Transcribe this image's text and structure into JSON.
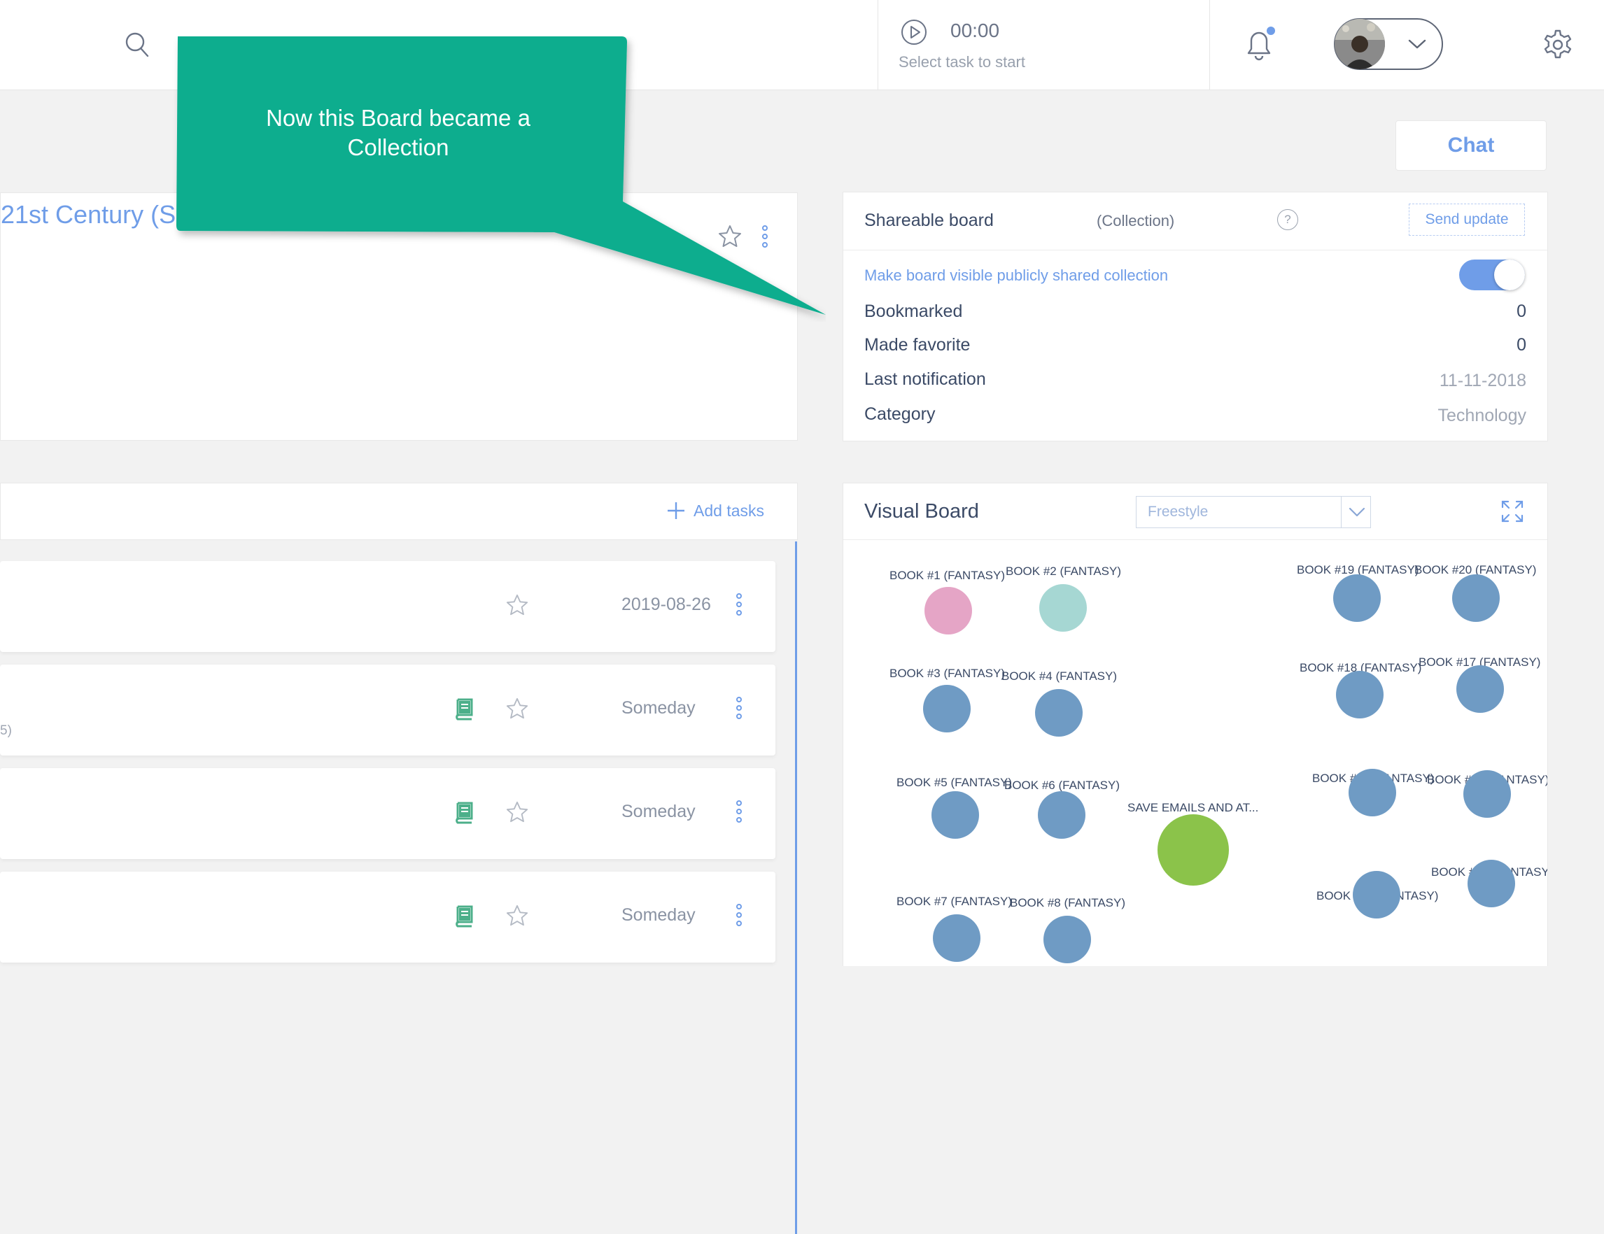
{
  "timer": {
    "time": "00:00",
    "hint": "Select task to start"
  },
  "header": {
    "chat_label": "Chat"
  },
  "board": {
    "title": "21st Century (Sc"
  },
  "callout": {
    "text": "Now this Board became a Collection"
  },
  "shareable": {
    "title": "Shareable board",
    "type": "(Collection)",
    "help": "?",
    "send_update": "Send update",
    "visibility_label": "Make board visible publicly shared collection",
    "visibility_on": true,
    "stats": [
      {
        "label": "Bookmarked",
        "value": "0"
      },
      {
        "label": "Made favorite",
        "value": "0"
      },
      {
        "label": "Last notification",
        "value": "11-11-2018"
      },
      {
        "label": "Category",
        "value": "Technology"
      }
    ]
  },
  "tasks": {
    "add_label": "Add tasks",
    "rows": [
      {
        "due": "2019-08-26",
        "note": ""
      },
      {
        "due": "Someday",
        "note": "5)"
      },
      {
        "due": "Someday",
        "note": ""
      },
      {
        "due": "Someday",
        "note": ""
      }
    ]
  },
  "visual_board": {
    "title": "Visual Board",
    "layout": "Freestyle",
    "nodes": [
      {
        "label": "BOOK #1 (FANTASY)",
        "color": "#e5a5c6"
      },
      {
        "label": "BOOK #2 (FANTASY)",
        "color": "#a6d7d3"
      },
      {
        "label": "BOOK #3 (FANTASY)",
        "color": "#6f9bc4"
      },
      {
        "label": "BOOK #4 (FANTASY)",
        "color": "#6f9bc4"
      },
      {
        "label": "BOOK #5 (FANTASY)",
        "color": "#6f9bc4"
      },
      {
        "label": "BOOK #6 (FANTASY)",
        "color": "#6f9bc4"
      },
      {
        "label": "BOOK #7 (FANTASY)",
        "color": "#6f9bc4"
      },
      {
        "label": "BOOK #8 (FANTASY)",
        "color": "#6f9bc4"
      },
      {
        "label": "SAVE EMAILS AND AT...",
        "color": "#8bc34a"
      },
      {
        "label": "BOOK #19 (FANTASY)",
        "color": "#6f9bc4"
      },
      {
        "label": "BOOK #20 (FANTASY)",
        "color": "#6f9bc4"
      },
      {
        "label": "BOOK #18 (FANTASY)",
        "color": "#6f9bc4"
      },
      {
        "label": "BOOK #17 (FANTASY)",
        "color": "#6f9bc4"
      },
      {
        "label": "BOOK #15 (FANTASY)",
        "color": "#6f9bc4"
      },
      {
        "label": "BOOK #16 (FANTASY)",
        "color": "#6f9bc4"
      },
      {
        "label": "BOOK #13 (FANTASY)",
        "color": "#6f9bc4"
      },
      {
        "label": "BOOK #14 (FANTASY)",
        "color": "#6f9bc4"
      }
    ]
  },
  "colors": {
    "accent": "#6f9de8",
    "callout": "#09ad8e",
    "book_icon": "#4caf8a"
  }
}
